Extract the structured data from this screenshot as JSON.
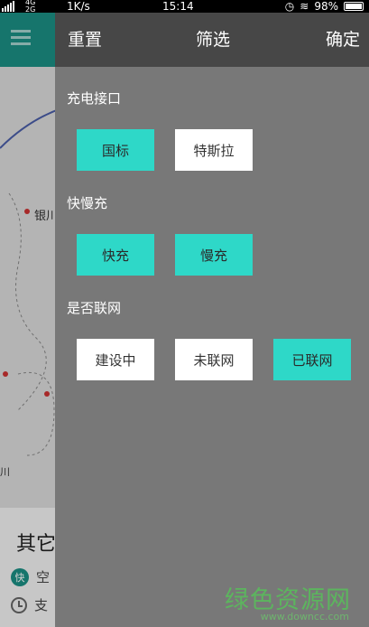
{
  "status_bar": {
    "network_top": "4G",
    "network_bottom": "2G",
    "speed": "1K/s",
    "time": "15:14",
    "battery": "98%"
  },
  "background": {
    "map_city_label": "银川",
    "map_side_label": "川",
    "card_title": "其它",
    "row1_badge": "快",
    "row1_text": "空",
    "row2_text": "支"
  },
  "drawer": {
    "reset_label": "重置",
    "title": "筛选",
    "confirm_label": "确定",
    "sections": [
      {
        "label": "充电接口",
        "options": [
          {
            "label": "国标",
            "selected": true
          },
          {
            "label": "特斯拉",
            "selected": false
          }
        ]
      },
      {
        "label": "快慢充",
        "options": [
          {
            "label": "快充",
            "selected": true
          },
          {
            "label": "慢充",
            "selected": true
          }
        ]
      },
      {
        "label": "是否联网",
        "options": [
          {
            "label": "建设中",
            "selected": false
          },
          {
            "label": "未联网",
            "selected": false
          },
          {
            "label": "已联网",
            "selected": true
          }
        ]
      }
    ]
  },
  "watermark": {
    "text": "绿色资源网",
    "url": "www.downcc.com"
  },
  "colors": {
    "accent_teal": "#2ed8c8",
    "header_teal": "#1c8f84",
    "drawer_bg": "#787878",
    "drawer_header": "#474747"
  }
}
